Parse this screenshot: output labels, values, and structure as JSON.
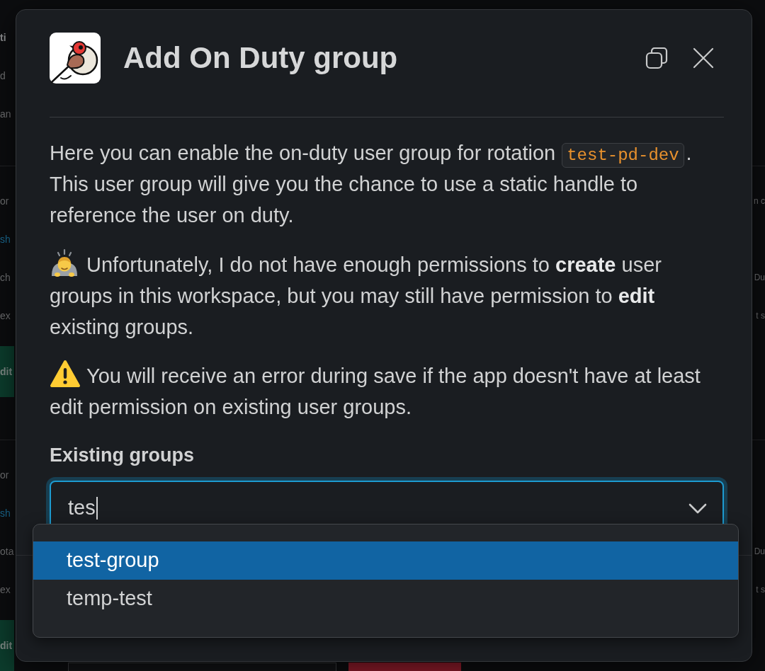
{
  "background": {
    "sections": [
      {
        "lines": [
          {
            "kind": "heading",
            "left": "ti"
          },
          {
            "kind": "text",
            "left": "d"
          },
          {
            "kind": "text",
            "left": "an"
          }
        ]
      },
      {
        "lines": [
          {
            "kind": "text",
            "left": "or",
            "right": "n c"
          },
          {
            "kind": "link",
            "left": "sh"
          },
          {
            "kind": "text",
            "left": "ch",
            "right": "Du"
          },
          {
            "kind": "text",
            "left": "ex",
            "right": "t s"
          },
          {
            "kind": "button",
            "left": "dit"
          }
        ]
      },
      {
        "lines": [
          {
            "kind": "text",
            "left": "or"
          },
          {
            "kind": "link",
            "left": "sh"
          },
          {
            "kind": "text",
            "left": "ota",
            "right": "Du"
          },
          {
            "kind": "text",
            "left": "ex",
            "right": "t s"
          },
          {
            "kind": "button",
            "left": "dit",
            "extra_buttons": [
              {
                "kind": "outline"
              },
              {
                "kind": "danger"
              }
            ]
          }
        ]
      }
    ]
  },
  "modal": {
    "title": "Add On Duty group",
    "intro": {
      "text": "Here you can enable the on-duty user group for rotation",
      "code": "test-pd-dev",
      "text_after": ". This user group will give you the chance to use a static handle to reference the user on duty."
    },
    "notices": [
      {
        "kind": "apology",
        "text": "Unfortunately, I do not have enough permissions to **create** user groups in this workspace, but you may still have permission to **edit** existing groups."
      },
      {
        "kind": "warning",
        "text": "You will receive an error during save if the app doesn't have at least edit permission on existing user groups."
      }
    ],
    "field": {
      "label": "Existing groups",
      "value": "tes",
      "focused": true,
      "expanded": true,
      "options": [
        {
          "label": "test-group",
          "selected": true
        },
        {
          "label": "temp-test",
          "selected": false
        }
      ]
    }
  }
}
